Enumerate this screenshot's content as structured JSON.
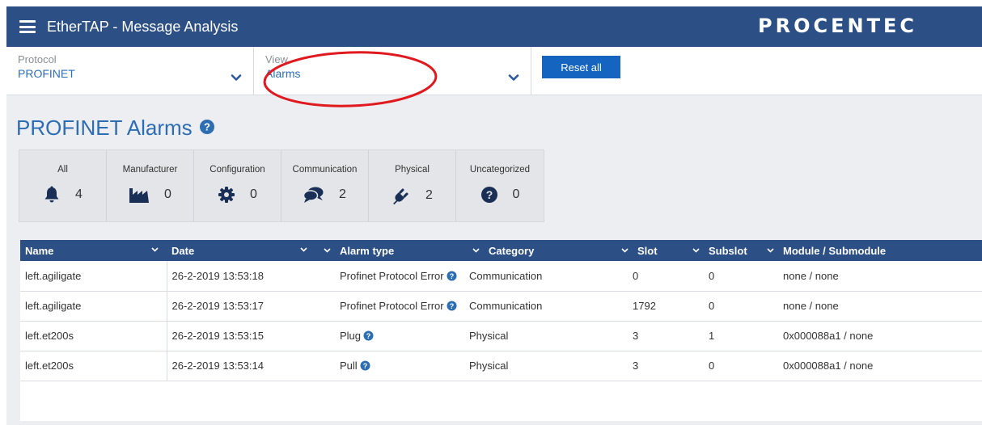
{
  "header": {
    "title": "EtherTAP - Message Analysis",
    "logo": "PROCENTEC"
  },
  "filters": {
    "protocol": {
      "label": "Protocol",
      "value": "PROFINET"
    },
    "view": {
      "label": "View",
      "value": "Alarms"
    },
    "reset_label": "Reset all"
  },
  "page": {
    "title": "PROFINET Alarms"
  },
  "categories": [
    {
      "name": "All",
      "icon": "bell-icon",
      "count": "4"
    },
    {
      "name": "Manufacturer",
      "icon": "factory-icon",
      "count": "0"
    },
    {
      "name": "Configuration",
      "icon": "gear-icon",
      "count": "0"
    },
    {
      "name": "Communication",
      "icon": "chat-icon",
      "count": "2"
    },
    {
      "name": "Physical",
      "icon": "plug-icon",
      "count": "2"
    },
    {
      "name": "Uncategorized",
      "icon": "question-icon",
      "count": "0"
    }
  ],
  "table": {
    "columns": [
      "Name",
      "Date",
      "Alarm type",
      "Category",
      "Slot",
      "Subslot",
      "Module / Submodule"
    ],
    "rows": [
      [
        "left.agiligate",
        "26-2-2019 13:53:18",
        "Profinet Protocol Error",
        "Communication",
        "0",
        "0",
        "none / none"
      ],
      [
        "left.agiligate",
        "26-2-2019 13:53:17",
        "Profinet Protocol Error",
        "Communication",
        "1792",
        "0",
        "none / none"
      ],
      [
        "left.et200s",
        "26-2-2019 13:53:15",
        "Plug",
        "Physical",
        "3",
        "1",
        "0x000088a1 / none"
      ],
      [
        "left.et200s",
        "26-2-2019 13:53:14",
        "Pull",
        "Physical",
        "3",
        "0",
        "0x000088a1 / none"
      ]
    ]
  },
  "colors": {
    "header_bg": "#2c4f86",
    "accent": "#2d6db3",
    "button": "#1565c0",
    "annotation": "#e0191f"
  }
}
